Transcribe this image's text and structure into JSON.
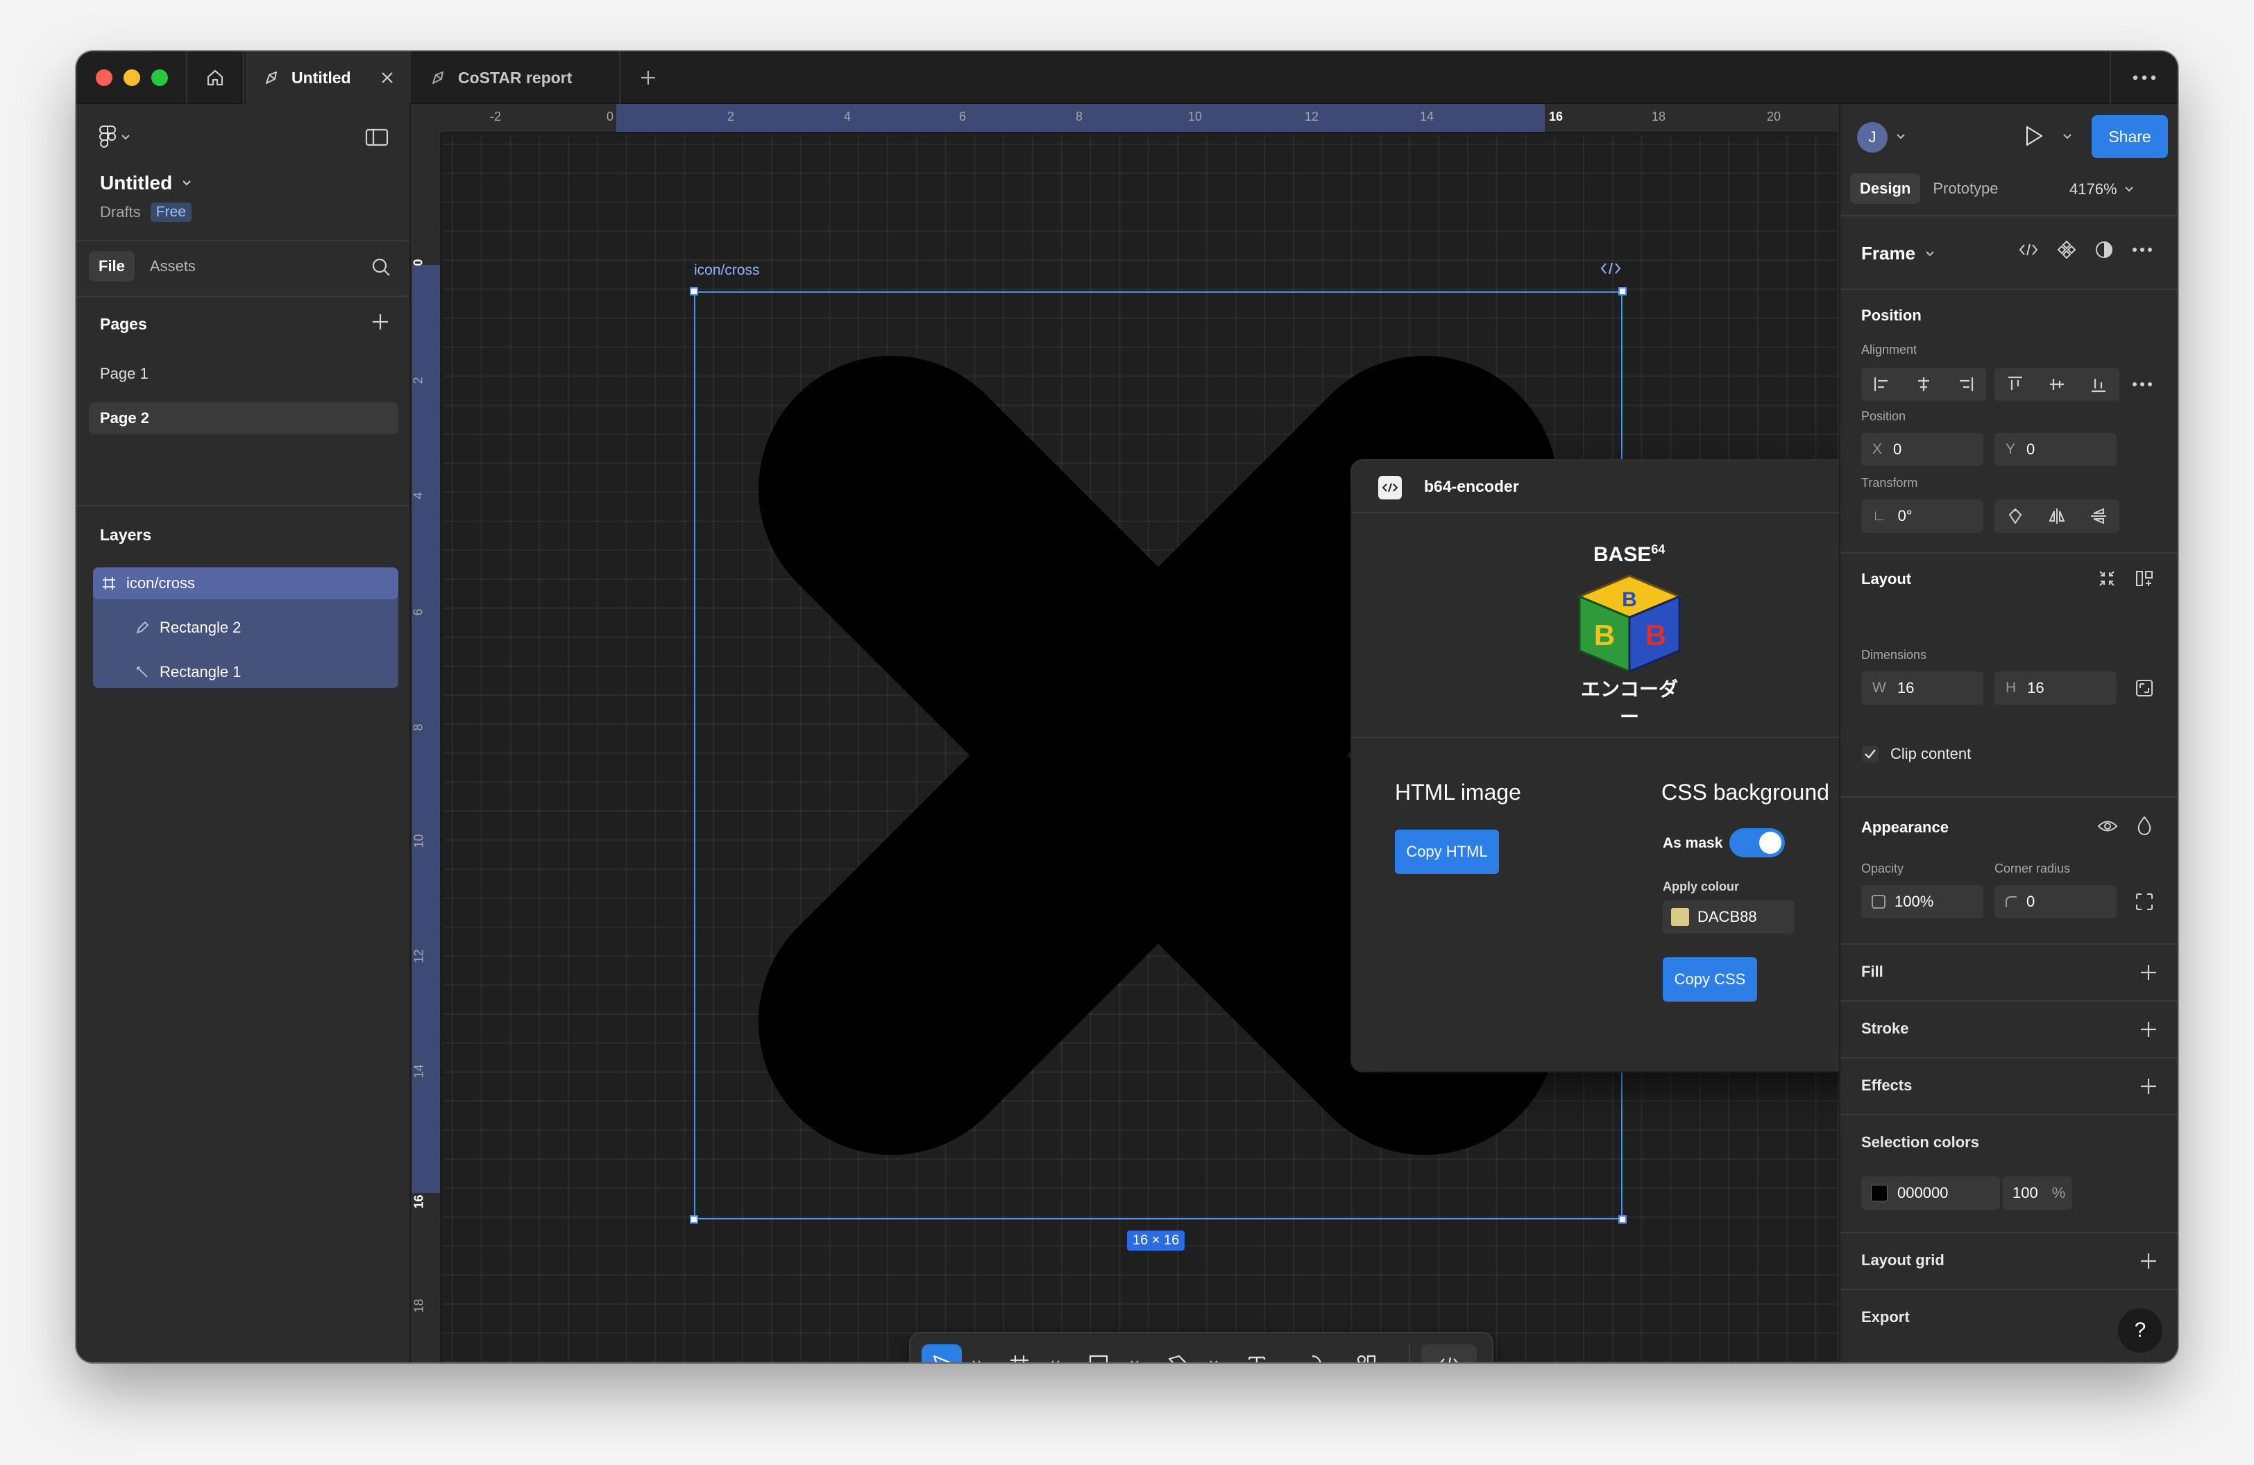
{
  "window": {
    "tabs": [
      {
        "label": "Untitled",
        "active": true
      },
      {
        "label": "CoSTAR report",
        "active": false
      }
    ]
  },
  "left_panel": {
    "file_name": "Untitled",
    "location": "Drafts",
    "plan_badge": "Free",
    "tabs": [
      "File",
      "Assets"
    ],
    "pages_header": "Pages",
    "pages": [
      "Page 1",
      "Page 2"
    ],
    "selected_page": "Page 2",
    "layers_header": "Layers",
    "layers": [
      {
        "name": "icon/cross",
        "icon": "frame-icon"
      },
      {
        "name": "Rectangle 2",
        "icon": "pencil-icon"
      },
      {
        "name": "Rectangle 1",
        "icon": "pencil-icon"
      }
    ]
  },
  "canvas": {
    "ruler_top": [
      "-2",
      "0",
      "2",
      "4",
      "6",
      "8",
      "10",
      "12",
      "14",
      "16",
      "18",
      "20"
    ],
    "ruler_left": [
      "0",
      "2",
      "4",
      "6",
      "8",
      "10",
      "12",
      "14",
      "16",
      "18"
    ],
    "frame_label": "icon/cross",
    "frame_size_badge": "16 × 16",
    "frame_stroke_color": "#4f8fff",
    "shape_fill_color": "#000000"
  },
  "toolbar": {
    "tools": [
      "move-icon",
      "frame-icon",
      "rectangle-icon",
      "pen-icon",
      "text-icon",
      "comment-icon",
      "resources-icon",
      "dev-mode-icon"
    ],
    "active_tool": "move-icon"
  },
  "plugin": {
    "title": "b64-encoder",
    "logo_text": "BASE",
    "logo_superscript": "64",
    "logo_japanese": "エンコーダー",
    "html_section_title": "HTML image",
    "copy_html_label": "Copy HTML",
    "css_section_title": "CSS background",
    "as_mask_label": "As mask",
    "as_mask_on": true,
    "apply_colour_label": "Apply colour",
    "colour_value": "DACB88",
    "colour_swatch": "#dacb88",
    "copy_css_label": "Copy CSS"
  },
  "right_panel": {
    "avatar_initial": "J",
    "share_label": "Share",
    "tabs": [
      "Design",
      "Prototype"
    ],
    "zoom": "4176%",
    "frame_type": "Frame",
    "position_header": "Position",
    "alignment_label": "Alignment",
    "position_label": "Position",
    "x_prefix": "X",
    "x_value": "0",
    "y_prefix": "Y",
    "y_value": "0",
    "transform_label": "Transform",
    "rotation_value": "0°",
    "layout_header": "Layout",
    "dimensions_label": "Dimensions",
    "w_prefix": "W",
    "w_value": "16",
    "h_prefix": "H",
    "h_value": "16",
    "clip_content_label": "Clip content",
    "clip_content_checked": true,
    "appearance_header": "Appearance",
    "opacity_label": "Opacity",
    "opacity_value": "100%",
    "corner_radius_label": "Corner radius",
    "corner_radius_value": "0",
    "fill_label": "Fill",
    "stroke_label": "Stroke",
    "effects_label": "Effects",
    "selection_colors_header": "Selection colors",
    "selection_color_hex": "000000",
    "selection_color_swatch": "#000000",
    "selection_color_opacity": "100",
    "selection_color_opacity_unit": "%",
    "layout_grid_label": "Layout grid",
    "export_label": "Export",
    "help_label": "?"
  }
}
